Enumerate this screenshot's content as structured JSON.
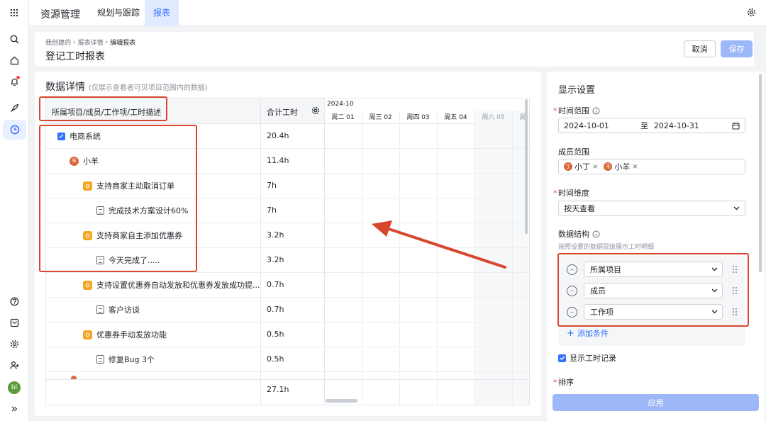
{
  "topbar": {
    "app_title": "资源管理",
    "tabs": [
      {
        "label": "规划与跟踪",
        "active": false
      },
      {
        "label": "报表",
        "active": true
      }
    ]
  },
  "header": {
    "breadcrumb": [
      "我创建的",
      "报表详情",
      "编辑报表"
    ],
    "title": "登记工时报表",
    "cancel_label": "取消",
    "save_label": "保存"
  },
  "data_panel": {
    "title": "数据详情",
    "note": "(仅展示查看者可见项目范围内的数据)",
    "columns": {
      "name": "所属项目/成员/工作项/工时描述",
      "hours": "合计工时"
    },
    "month": "2024-10",
    "days": [
      "周二 01",
      "周三 02",
      "周四 03",
      "周五 04",
      "周六 05",
      "周"
    ],
    "rows": [
      {
        "type": "project",
        "name": "电商系统",
        "hours": "20.4h"
      },
      {
        "type": "member",
        "name": "小羊",
        "avatar": "羊",
        "hours": "11.4h"
      },
      {
        "type": "task",
        "name": "支持商家主动取消订单",
        "hours": "7h"
      },
      {
        "type": "log",
        "name": "完成技术方案设计60%",
        "hours": "7h"
      },
      {
        "type": "task",
        "name": "支持商家自主添加优惠券",
        "hours": "3.2h"
      },
      {
        "type": "log",
        "name": "今天完成了.....",
        "hours": "3.2h"
      },
      {
        "type": "task",
        "name": "支持设置优惠券自动发放和优惠券发放成功提...",
        "hours": "0.7h"
      },
      {
        "type": "log",
        "name": "客户访谈",
        "hours": "0.7h"
      },
      {
        "type": "task",
        "name": "优惠券手动发放功能",
        "hours": "0.5h"
      },
      {
        "type": "log",
        "name": "修复Bug 3个",
        "hours": "0.5h"
      }
    ],
    "total": "27.1h"
  },
  "settings": {
    "title": "显示设置",
    "time_range": {
      "label": "时间范围",
      "start": "2024-10-01",
      "to": "至",
      "end": "2024-10-31"
    },
    "member_range": {
      "label": "成员范围",
      "members": [
        {
          "name": "小丁",
          "avatar": "丁"
        },
        {
          "name": "小羊",
          "avatar": "羊"
        }
      ]
    },
    "time_dimension": {
      "label": "时间维度",
      "value": "按天查看"
    },
    "structure": {
      "label": "数据结构",
      "hint": "按照设置的数据层级展示工时明细",
      "levels": [
        "所属项目",
        "成员",
        "工作项"
      ],
      "add_label": "添加条件"
    },
    "show_records": "显示工时记录",
    "sort_label": "排序",
    "apply_label": "应用"
  },
  "colors": {
    "accent": "#3370ff",
    "annotation": "#d8462e",
    "task_icon": "#f5a623",
    "member_avatar": "#d9673a"
  }
}
